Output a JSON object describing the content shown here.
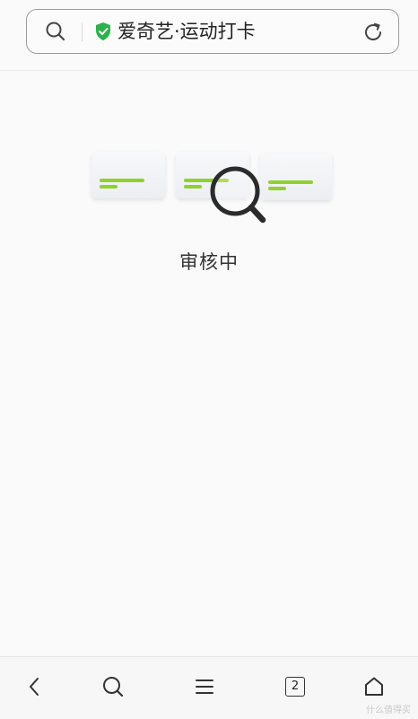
{
  "address_bar": {
    "title": "爱奇艺·运动打卡",
    "search_icon": "search-icon",
    "secure_icon": "shield-check-icon",
    "secure_color": "#2bb24c",
    "refresh_icon": "refresh-icon"
  },
  "content": {
    "status": "审核中",
    "illustration_icon": "reviewing-magnifier-illustration",
    "accent_color": "#8fd22b"
  },
  "bottom_nav": {
    "items": [
      {
        "icon": "back-icon"
      },
      {
        "icon": "search-icon"
      },
      {
        "icon": "menu-icon"
      },
      {
        "icon": "tabs-icon",
        "count": "2"
      },
      {
        "icon": "home-icon"
      }
    ]
  },
  "watermark": "什么值得买"
}
